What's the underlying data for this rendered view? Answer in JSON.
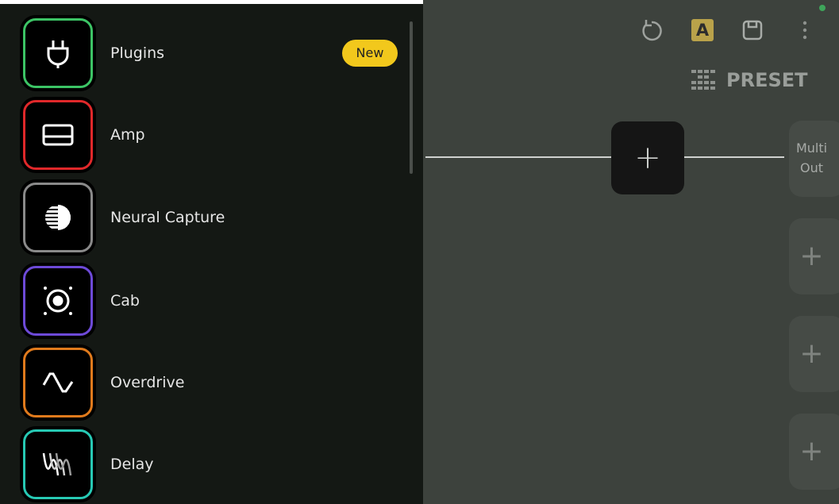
{
  "sidebar": {
    "items": [
      {
        "label": "Plugins",
        "icon": "plug-icon",
        "color": "#3cc465",
        "badge": "New"
      },
      {
        "label": "Amp",
        "icon": "amp-icon",
        "color": "#e0282a"
      },
      {
        "label": "Neural Capture",
        "icon": "neural-capture-icon",
        "color": "#8a8a8a"
      },
      {
        "label": "Cab",
        "icon": "speaker-icon",
        "color": "#6d4ad8"
      },
      {
        "label": "Overdrive",
        "icon": "waveform-icon",
        "color": "#e07a1c"
      },
      {
        "label": "Delay",
        "icon": "delay-waves-icon",
        "color": "#27c9b4"
      }
    ]
  },
  "toolbar": {
    "undo_icon": "undo-icon",
    "ab_label": "A",
    "save_icon": "save-icon",
    "more_icon": "more-vertical-icon"
  },
  "canvas": {
    "preset_label": "PRESET",
    "add_block_symbol": "+",
    "outputs": [
      {
        "label_line1": "Multi",
        "label_line2": "Out"
      },
      {
        "symbol": "+"
      },
      {
        "symbol": "+"
      },
      {
        "symbol": "+"
      }
    ]
  },
  "colors": {
    "badge": "#f2c81c",
    "status": "#3ea55a"
  }
}
